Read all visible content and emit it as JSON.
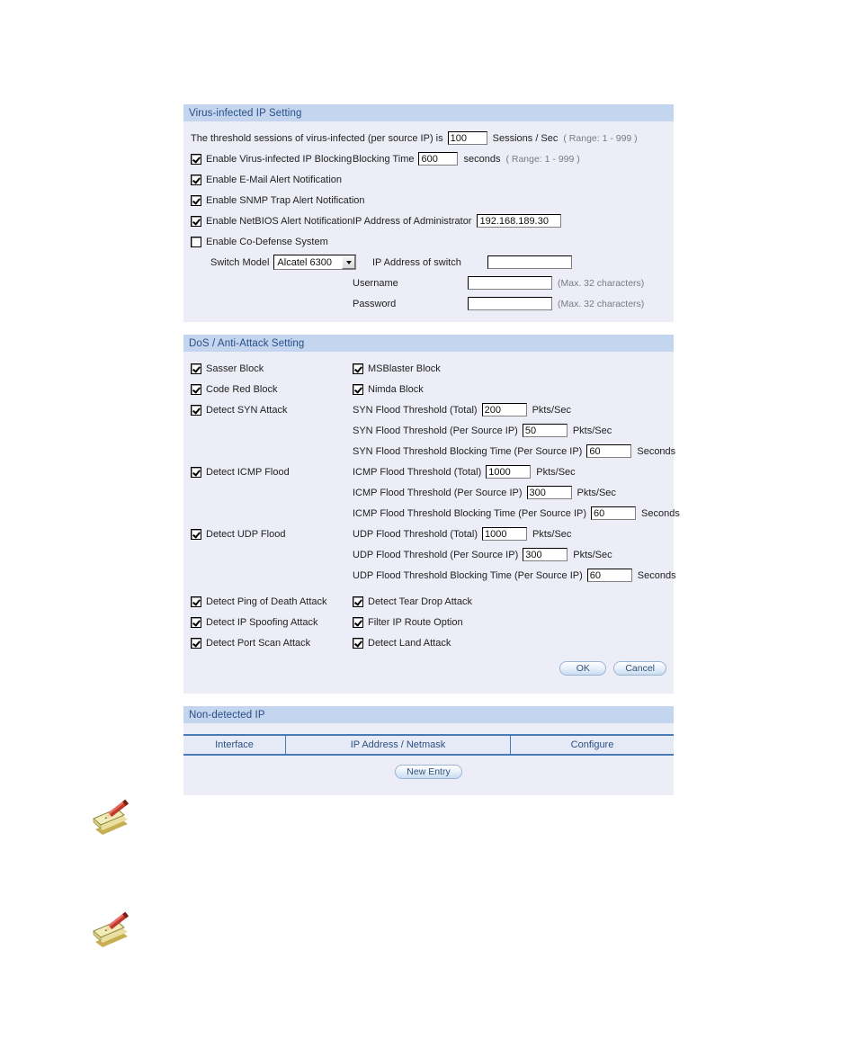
{
  "sections": {
    "virus": {
      "title": "Virus-infected IP Setting",
      "threshold_prefix": "The threshold sessions of virus-infected (per source IP) is",
      "threshold_value": "100",
      "threshold_unit": "Sessions / Sec",
      "threshold_range": "( Range: 1 - 999 )",
      "enable_blocking_label": "Enable Virus-infected IP Blocking",
      "enable_blocking_checked": true,
      "blocking_time_label": "Blocking Time",
      "blocking_time_value": "600",
      "blocking_time_unit": "seconds",
      "blocking_time_range": "( Range: 1 - 999 )",
      "enable_email_label": "Enable E-Mail Alert Notification",
      "enable_email_checked": true,
      "enable_snmp_label": "Enable SNMP Trap Alert Notification",
      "enable_snmp_checked": true,
      "enable_netbios_label": "Enable NetBIOS Alert Notification",
      "enable_netbios_checked": true,
      "admin_ip_label": "IP Address of Administrator",
      "admin_ip_value": "192.168.189.30",
      "enable_codefense_label": "Enable Co-Defense System",
      "enable_codefense_checked": false,
      "switch_model_label": "Switch Model",
      "switch_model_value": "Alcatel 6300",
      "switch_ip_label": "IP Address of switch",
      "switch_ip_value": "",
      "username_label": "Username",
      "username_value": "",
      "username_hint": "(Max. 32 characters)",
      "password_label": "Password",
      "password_value": "",
      "password_hint": "(Max. 32 characters)"
    },
    "dos": {
      "title": "DoS / Anti-Attack Setting",
      "sasser_label": "Sasser Block",
      "sasser_checked": true,
      "msblaster_label": "MSBlaster Block",
      "msblaster_checked": true,
      "codered_label": "Code Red Block",
      "codered_checked": true,
      "nimda_label": "Nimda Block",
      "nimda_checked": true,
      "syn_label": "Detect SYN Attack",
      "syn_checked": true,
      "syn_total_label": "SYN Flood Threshold (Total)",
      "syn_total_value": "200",
      "syn_total_unit": "Pkts/Sec",
      "syn_per_label": "SYN Flood Threshold (Per Source IP)",
      "syn_per_value": "50",
      "syn_per_unit": "Pkts/Sec",
      "syn_block_label": "SYN Flood Threshold Blocking Time (Per Source IP)",
      "syn_block_value": "60",
      "syn_block_unit": "Seconds",
      "icmp_label": "Detect ICMP Flood",
      "icmp_checked": true,
      "icmp_total_label": "ICMP Flood Threshold (Total)",
      "icmp_total_value": "1000",
      "icmp_total_unit": "Pkts/Sec",
      "icmp_per_label": "ICMP Flood Threshold (Per Source IP)",
      "icmp_per_value": "300",
      "icmp_per_unit": "Pkts/Sec",
      "icmp_block_label": "ICMP Flood Threshold Blocking Time (Per Source IP)",
      "icmp_block_value": "60",
      "icmp_block_unit": "Seconds",
      "udp_label": "Detect UDP Flood",
      "udp_checked": true,
      "udp_total_label": "UDP Flood Threshold (Total)",
      "udp_total_value": "1000",
      "udp_total_unit": "Pkts/Sec",
      "udp_per_label": "UDP Flood Threshold (Per Source IP)",
      "udp_per_value": "300",
      "udp_per_unit": "Pkts/Sec",
      "udp_block_label": "UDP Flood Threshold Blocking Time (Per Source IP)",
      "udp_block_value": "60",
      "udp_block_unit": "Seconds",
      "ping_death_label": "Detect Ping of Death Attack",
      "ping_death_checked": true,
      "teardrop_label": "Detect Tear Drop Attack",
      "teardrop_checked": true,
      "ip_spoofing_label": "Detect IP Spoofing Attack",
      "ip_spoofing_checked": true,
      "filter_route_label": "Filter IP Route Option",
      "filter_route_checked": true,
      "port_scan_label": "Detect Port Scan Attack",
      "port_scan_checked": true,
      "land_attack_label": "Detect Land Attack",
      "land_attack_checked": true,
      "ok_label": "OK",
      "cancel_label": "Cancel"
    },
    "nondetected": {
      "title": "Non-detected IP",
      "columns": [
        "Interface",
        "IP Address / Netmask",
        "Configure"
      ],
      "rows": [],
      "new_entry_label": "New Entry"
    }
  },
  "colors": {
    "section_header_bg": "#c3d5ef",
    "section_header_text": "#2b4f85",
    "panel_bg": "#ecedf6",
    "table_border": "#4a7ab5",
    "button_text": "#33527a"
  }
}
